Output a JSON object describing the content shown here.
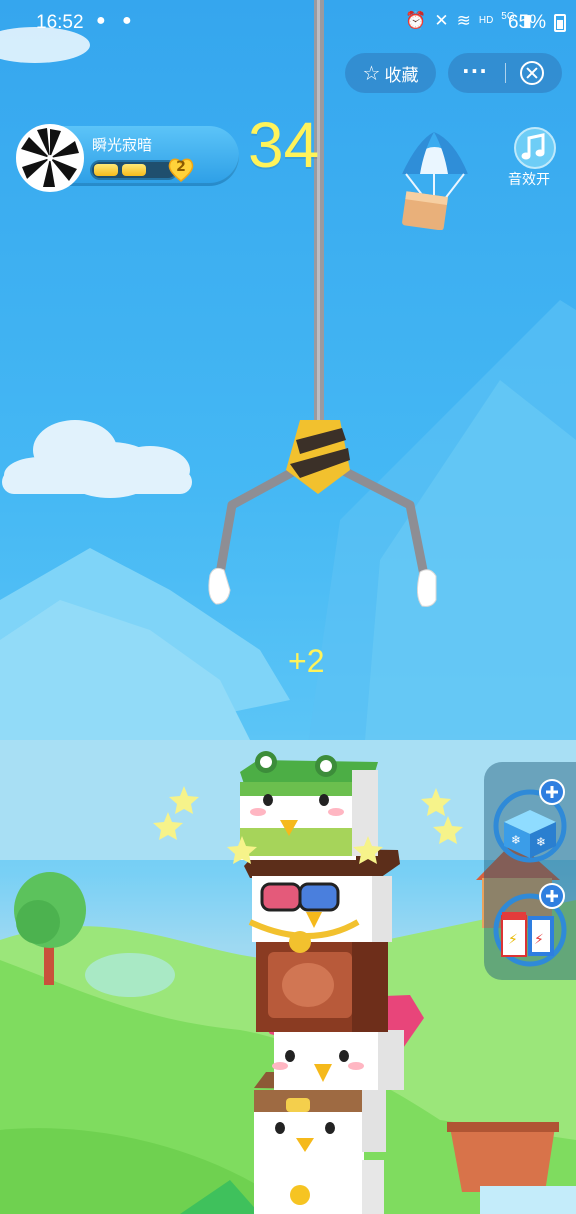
{
  "status_bar": {
    "time": "16:52",
    "icons": [
      "alarm-icon",
      "mute-icon",
      "wifi-icon",
      "HD",
      "5G",
      "signal-icon"
    ],
    "hd_label": "HD",
    "network_label": "5G",
    "battery": "65%"
  },
  "capsule": {
    "favorite_label": "收藏",
    "more_label": "···"
  },
  "player": {
    "name": "瞬光寂暗",
    "level": "2",
    "xp_segments_filled": 2,
    "xp_segments_total": 3
  },
  "score": "34",
  "sound": {
    "label": "音效开"
  },
  "popup": {
    "bonus_text": "+2"
  },
  "powerups": [
    {
      "name": "freeze-powerup",
      "icon": "ice-box-icon"
    },
    {
      "name": "energy-powerup",
      "icon": "battery-box-icon"
    }
  ],
  "colors": {
    "score": "#fff35a",
    "sky": "#3fb2f2",
    "grass": "#8be46b"
  }
}
